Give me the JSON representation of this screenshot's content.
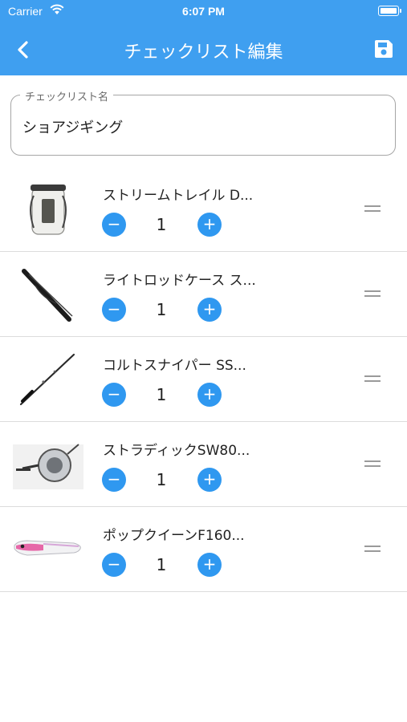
{
  "status_bar": {
    "carrier": "Carrier",
    "time": "6:07 PM"
  },
  "header": {
    "title": "チェックリスト編集",
    "back_icon": "back-chevron-icon",
    "save_icon": "save-icon"
  },
  "checklist_name": {
    "label": "チェックリスト名",
    "value": "ショアジギング"
  },
  "controls": {
    "minus": "−",
    "plus": "+"
  },
  "items": [
    {
      "name": "ストリームトレイル D...",
      "quantity": "1",
      "image": "dry-backpack-image"
    },
    {
      "name": "ライトロッドケース ス...",
      "quantity": "1",
      "image": "rod-case-image"
    },
    {
      "name": "コルトスナイパー SS...",
      "quantity": "1",
      "image": "fishing-rod-image"
    },
    {
      "name": "ストラディックSW80...",
      "quantity": "1",
      "image": "spinning-reel-image"
    },
    {
      "name": "ポップクイーンF160...",
      "quantity": "1",
      "image": "popper-lure-image"
    }
  ],
  "colors": {
    "accent": "#3f9ff0",
    "button": "#2f98f0"
  }
}
